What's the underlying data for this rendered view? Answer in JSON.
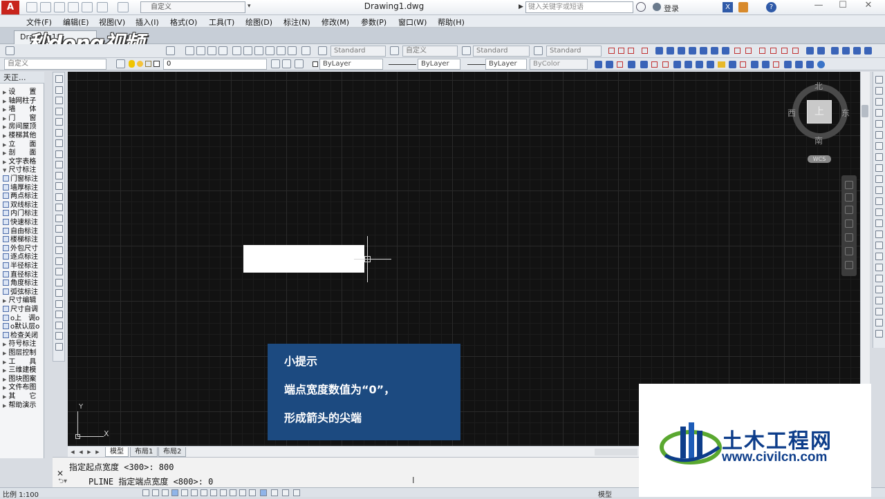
{
  "titlebar": {
    "app_logo": "A",
    "workspace": "自定义",
    "doc_title": "Drawing1.dwg",
    "search_placeholder": "键入关键字或短语",
    "login": "登录",
    "min": "—",
    "max": "☐",
    "close": "✕"
  },
  "menubar": [
    "文件(F)",
    "编辑(E)",
    "视图(V)",
    "插入(I)",
    "格式(O)",
    "工具(T)",
    "绘图(D)",
    "标注(N)",
    "修改(M)",
    "参数(P)",
    "窗口(W)",
    "帮助(H)"
  ],
  "tab": {
    "label": "Drawing1*"
  },
  "watermark": "秒dong视频",
  "toolbar1": {
    "text_style": "Standard",
    "dim_style": "自定义",
    "table_style": "Standard",
    "mleader_style": "Standard"
  },
  "toolbar2": {
    "workspace": "自定义",
    "layer": "0",
    "color": "ByLayer",
    "linetype": "ByLayer",
    "lineweight": "ByLayer",
    "plotstyle": "ByColor"
  },
  "left_panel": {
    "title": "天正...",
    "items": [
      {
        "label": "设　　置",
        "type": "tri"
      },
      {
        "label": "轴网柱子",
        "type": "tri"
      },
      {
        "label": "墙　　体",
        "type": "tri"
      },
      {
        "label": "门　　窗",
        "type": "tri"
      },
      {
        "label": "房间屋顶",
        "type": "tri"
      },
      {
        "label": "楼梯其他",
        "type": "tri"
      },
      {
        "label": "立　　面",
        "type": "tri"
      },
      {
        "label": "剖　　面",
        "type": "tri"
      },
      {
        "label": "文字表格",
        "type": "tri"
      },
      {
        "label": "尺寸标注",
        "type": "open"
      },
      {
        "label": "门窗标注",
        "type": "icon"
      },
      {
        "label": "墙厚标注",
        "type": "icon"
      },
      {
        "label": "两点标注",
        "type": "icon"
      },
      {
        "label": "双线标注",
        "type": "icon"
      },
      {
        "label": "内门标注",
        "type": "icon"
      },
      {
        "label": "快速标注",
        "type": "icon"
      },
      {
        "label": "自由标注",
        "type": "icon"
      },
      {
        "label": "楼梯标注",
        "type": "icon"
      },
      {
        "label": "外包尺寸",
        "type": "icon"
      },
      {
        "label": "逐点标注",
        "type": "icon"
      },
      {
        "label": "半径标注",
        "type": "icon"
      },
      {
        "label": "直径标注",
        "type": "icon"
      },
      {
        "label": "角度标注",
        "type": "icon"
      },
      {
        "label": "弧弦标注",
        "type": "icon"
      },
      {
        "label": "尺寸编辑",
        "type": "tri"
      },
      {
        "label": "尺寸自调",
        "type": "icon"
      },
      {
        "label": "o上　调o",
        "type": "icon"
      },
      {
        "label": "o默认层o",
        "type": "icon"
      },
      {
        "label": "检查关闭",
        "type": "icon"
      },
      {
        "label": "符号标注",
        "type": "tri"
      },
      {
        "label": "图层控制",
        "type": "tri"
      },
      {
        "label": "工　　具",
        "type": "tri"
      },
      {
        "label": "三维建模",
        "type": "tri"
      },
      {
        "label": "图块图案",
        "type": "tri"
      },
      {
        "label": "文件布图",
        "type": "tri"
      },
      {
        "label": "其　　它",
        "type": "tri"
      },
      {
        "label": "帮助演示",
        "type": "tri"
      }
    ]
  },
  "viewcube": {
    "top": "上",
    "north": "北",
    "south": "南",
    "east": "东",
    "west": "西",
    "wcs": "WCS"
  },
  "ucs": {
    "x": "X",
    "y": "Y"
  },
  "tip": {
    "title": "小提示",
    "line1": "端点宽度数值为“0”，",
    "line2": "形成箭头的尖端"
  },
  "layout_tabs": [
    "模型",
    "布局1",
    "布局2"
  ],
  "command": {
    "line1": "指定起点宽度 <300>: 800",
    "line2": "PLINE 指定端点宽度 <800>: 0",
    "close": "✕"
  },
  "statusbar": {
    "scale": "比例 1:100",
    "model": "模型"
  },
  "logo": {
    "cn": "土木工程网",
    "url": "www.civilcn.com"
  }
}
